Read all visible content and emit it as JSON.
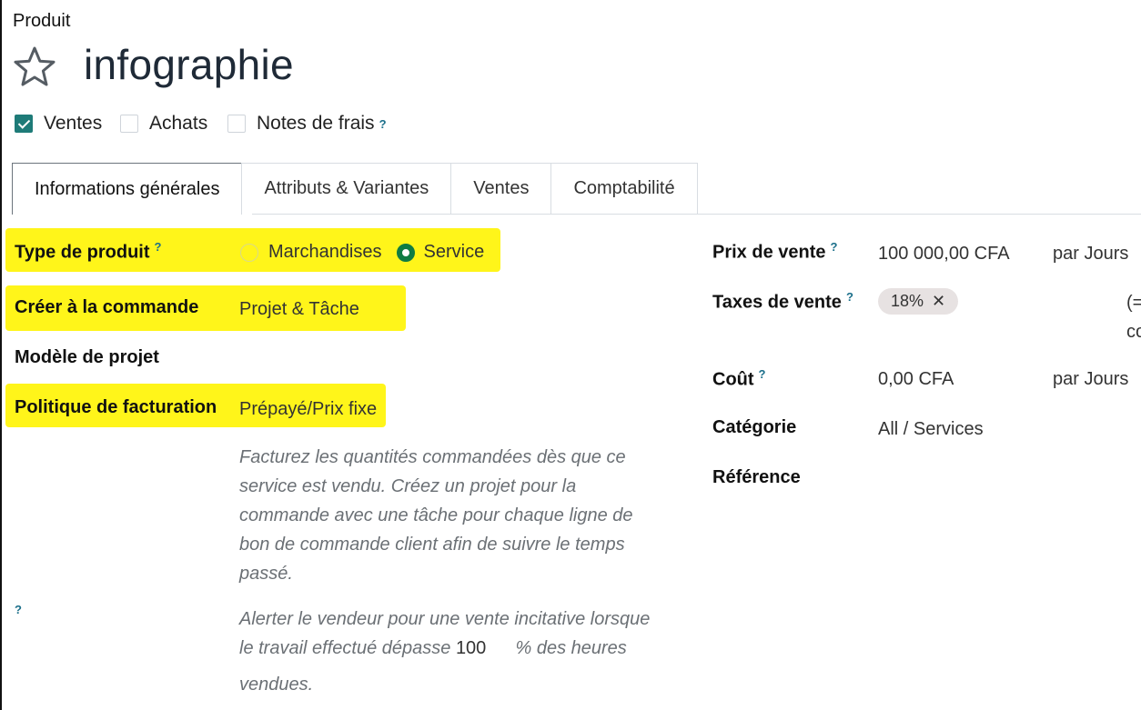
{
  "breadcrumb": "Produit",
  "product": {
    "name": "infographie"
  },
  "options": [
    {
      "label": "Ventes",
      "checked": true
    },
    {
      "label": "Achats",
      "checked": false
    },
    {
      "label": "Notes de frais",
      "checked": false,
      "help": "?"
    }
  ],
  "tabs": [
    "Informations générales",
    "Attributs & Variantes",
    "Ventes",
    "Comptabilité"
  ],
  "left": {
    "type_label": "Type de produit",
    "type_help": "?",
    "type_options": [
      "Marchandises",
      "Service"
    ],
    "type_selected": "Service",
    "create_label": "Créer à la commande",
    "create_value": "Projet & Tâche",
    "model_label": "Modèle de projet",
    "policy_label": "Politique de facturation",
    "policy_value": "Prépayé/Prix fixe",
    "policy_desc": [
      "Facturez les quantités commandées dès que ce",
      "service est vendu. Créez un projet pour la",
      "commande avec une tâche pour chaque ligne de",
      "bon de commande client afin de suivre le temps",
      "passé."
    ],
    "alert_help": "?",
    "alert_line1": "Alerter le vendeur pour une vente incitative lorsque",
    "alert_line2_prefix": "le travail effectué dépasse",
    "alert_percent": "100",
    "alert_line2_suffix": "% des heures",
    "alert_line3": "vendues."
  },
  "right": {
    "price_label": "Prix de vente",
    "price_help": "?",
    "price_value": "100 000,00 CFA",
    "price_unit": "par Jours",
    "taxes_label": "Taxes de vente",
    "taxes_help": "?",
    "tax_tag": "18%",
    "tax_tag_remove": "✕",
    "taxes_side_1": "(=",
    "taxes_side_2": "co",
    "cost_label": "Coût",
    "cost_help": "?",
    "cost_value": "0,00 CFA",
    "cost_unit": "par Jours",
    "category_label": "Catégorie",
    "category_value": "All / Services",
    "reference_label": "Référence"
  },
  "colors": {
    "highlight": "#fff51a",
    "accent": "#1e7b78",
    "radio_on": "#0f7c43",
    "help": "#1b6f8a"
  },
  "icons": {
    "favorite": "star-icon",
    "check": "check-icon",
    "remove": "close-icon"
  }
}
